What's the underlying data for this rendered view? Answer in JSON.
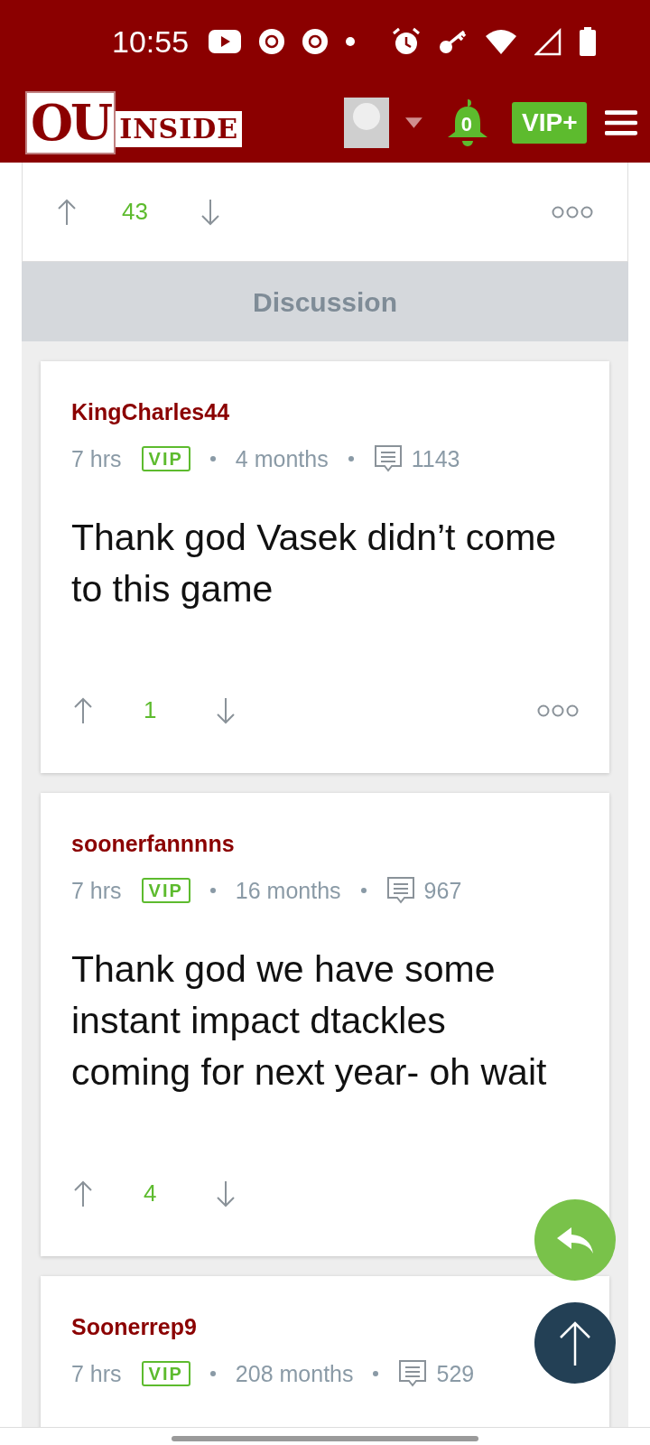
{
  "status_bar": {
    "time": "10:55"
  },
  "header": {
    "logo_main": "OU",
    "logo_sub": "INSIDE",
    "notifications": "0",
    "vip_button": "VIP+"
  },
  "top_post": {
    "votes": "43"
  },
  "discussion": {
    "title": "Discussion"
  },
  "comments": [
    {
      "author": "KingCharles44",
      "time": "7 hrs",
      "badge": "VIP",
      "tenure": "4 months",
      "posts": "1143",
      "text": "Thank god Vasek didn’t come to this game",
      "votes": "1",
      "more_menu": true
    },
    {
      "author": "soonerfannnns",
      "time": "7 hrs",
      "badge": "VIP",
      "tenure": "16 months",
      "posts": "967",
      "text": "Thank god we have some instant impact dtackles coming for next year- oh wait",
      "votes": "4",
      "more_menu": false
    },
    {
      "author": "Soonerrep9",
      "time": "7 hrs",
      "badge": "VIP",
      "tenure": "208 months",
      "posts": "529"
    }
  ]
}
